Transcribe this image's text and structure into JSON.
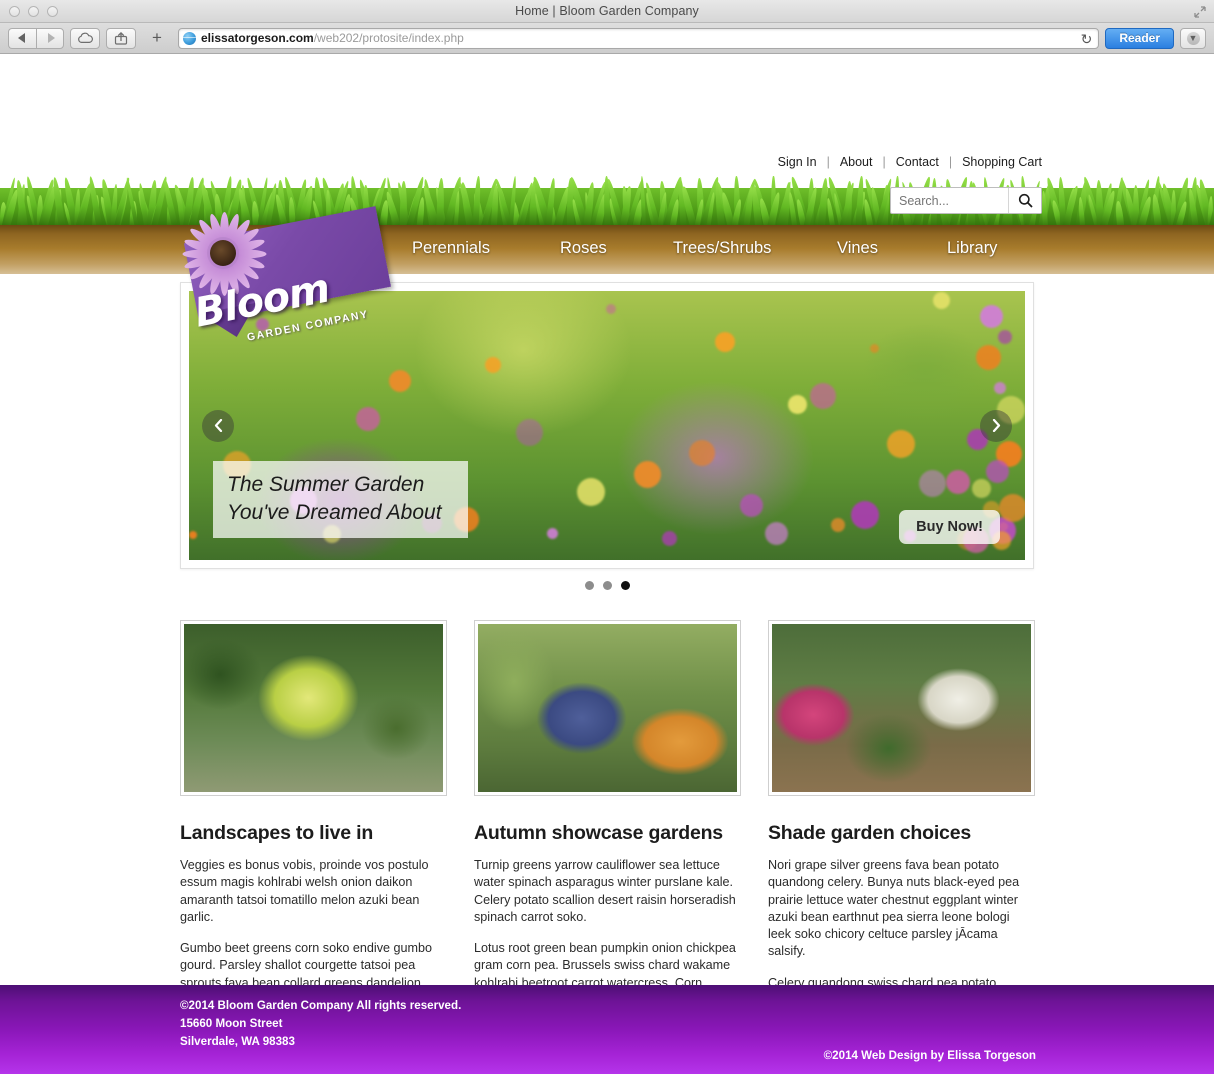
{
  "browser": {
    "window_title": "Home | Bloom Garden Company",
    "url_domain": "elissatorgeson.com",
    "url_path": "/web202/protosite/index.php",
    "reader_label": "Reader",
    "back_icon": "back-arrow-icon",
    "forward_icon": "forward-arrow-icon",
    "cloud_icon": "icloud-tabs-icon",
    "share_icon": "share-icon",
    "new_tab_icon": "plus-icon",
    "reload_icon": "reload-icon",
    "download_icon": "download-icon",
    "fullscreen_icon": "fullscreen-icon"
  },
  "utility_nav": {
    "items": [
      {
        "label": "Sign In"
      },
      {
        "label": "About"
      },
      {
        "label": "Contact"
      },
      {
        "label": "Shopping Cart"
      }
    ],
    "separator": "|"
  },
  "search": {
    "placeholder": "Search...",
    "value": "",
    "icon": "search-icon"
  },
  "logo": {
    "name": "Bloom",
    "tagline": "GARDEN COMPANY",
    "brand_purple": "#7a4aa8",
    "flower_icon": "daisy-flower-icon"
  },
  "main_nav": {
    "items": [
      {
        "label": "Perennials"
      },
      {
        "label": "Roses"
      },
      {
        "label": "Trees/Shrubs"
      },
      {
        "label": "Vines"
      },
      {
        "label": "Library"
      }
    ],
    "bar_color": "#a87c2c"
  },
  "hero": {
    "caption": "The Summer Garden\nYou've Dreamed About",
    "cta_label": "Buy Now!",
    "prev_icon": "chevron-left-icon",
    "next_icon": "chevron-right-icon",
    "slide_count": 3,
    "active_slide": 3,
    "image_alt": "summer-garden-flowers-photo"
  },
  "columns": [
    {
      "heading": "Landscapes to live in",
      "image_alt": "landscape-garden-photo",
      "paragraph1": "Veggies es bonus vobis, proinde vos postulo essum magis kohlrabi welsh onion daikon amaranth tatsoi tomatillo melon azuki bean garlic.",
      "paragraph2": "Gumbo beet greens corn soko endive gumbo gourd. Parsley shallot courgette tatsoi pea sprouts fava bean collard greens dandelion okra wakame tomato. Dandelion cucumber earthnut pea peanut soko zucchini."
    },
    {
      "heading": "Autumn showcase gardens",
      "image_alt": "autumn-showcase-garden-photo",
      "paragraph1": "Turnip greens yarrow cauliflower sea lettuce water spinach asparagus winter purslane kale. Celery potato scallion desert raisin horseradish spinach carrot soko.",
      "paragraph2": "Lotus root green bean pumpkin onion chickpea gram corn pea. Brussels swiss chard wakame kohlrabi beetroot carrot watercress. Corn amaranth salsify bunya nuts nori azuki bean chickweed potato bell pepper artichoke."
    },
    {
      "heading": "Shade garden choices",
      "image_alt": "shade-garden-photo",
      "paragraph1": "Nori grape silver greens fava bean potato quandong celery. Bunya nuts black-eyed pea prairie lettuce water chestnut eggplant winter azuki bean earthnut pea sierra leone bologi leek soko chicory celtuce parsley jĀcama salsify.",
      "paragraph2": "Celery quandong swiss chard pea potato. Salsify taro catsear garlic gram celery bitterleaf wattle seed collard greens nori."
    }
  ],
  "footer": {
    "copyright": "©2014 Bloom Garden Company   All rights reserved.",
    "address_line1": "15660 Moon Street",
    "address_line2": "Silverdale, WA 98383",
    "credit": "©2014 Web Design by Elissa Torgeson",
    "background_color": "#8a17b8"
  }
}
